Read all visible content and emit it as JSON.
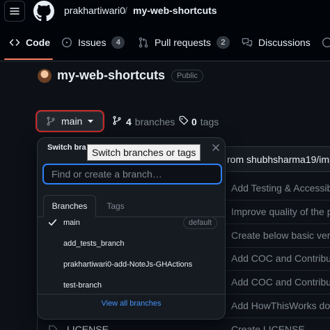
{
  "header": {
    "owner": "prakhartiwari0",
    "separator": "/",
    "repo": "my-web-shortcuts"
  },
  "tabs": [
    {
      "label": "Code",
      "icon": "code-icon"
    },
    {
      "label": "Issues",
      "icon": "issue-opened-icon",
      "count": "4"
    },
    {
      "label": "Pull requests",
      "icon": "git-pull-request-icon",
      "count": "2"
    },
    {
      "label": "Discussions",
      "icon": "comment-discussion-icon"
    }
  ],
  "repo": {
    "title": "my-web-shortcuts",
    "visibility": "Public"
  },
  "branch_bar": {
    "current_branch": "main",
    "branches_count": "4",
    "branches_label": "branches",
    "tags_count": "0",
    "tags_label": "tags"
  },
  "file_list": {
    "latest_commit": "rom shubhsharma19/impro",
    "rows": [
      {
        "msg": "Add Testing & Accessibili"
      },
      {
        "msg": "Improve quality of the pop"
      },
      {
        "msg": "Create below basic versio"
      },
      {
        "msg": "Add COC and Contributin"
      },
      {
        "msg": "Add COC and Contributin"
      },
      {
        "msg": "Add HowThisWorks docu"
      },
      {
        "name": "LICENSE",
        "msg": "Create LICENSE"
      }
    ]
  },
  "dropdown": {
    "title": "Switch bra",
    "search_placeholder": "Find or create a branch…",
    "tabs": [
      "Branches",
      "Tags"
    ],
    "branches": [
      {
        "name": "main",
        "selected": true,
        "badge": "default"
      },
      {
        "name": "add_tests_branch"
      },
      {
        "name": "prakhartiwari0-add-NoteJs-GHActions"
      },
      {
        "name": "test-branch"
      }
    ],
    "footer_link": "View all branches"
  },
  "tooltip": "Switch branches or tags",
  "colors": {
    "background": "#0d1117",
    "header_bg": "#010409",
    "accent_link": "#4493f8",
    "tab_underline": "#f78166",
    "focus_ring": "#2f81f7",
    "highlight_outline": "#c62828"
  }
}
